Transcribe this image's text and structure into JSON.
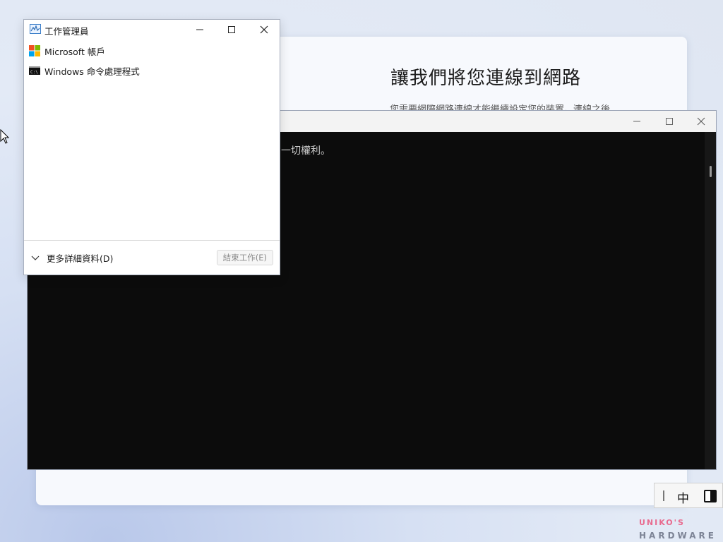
{
  "oobe": {
    "title": "讓我們將您連線到網路",
    "description": "您需要網際網路連線才能繼續設定您的裝置。連線之後，"
  },
  "cmd": {
    "visible_text": "一切權利。",
    "controls": {
      "minimize": "—",
      "maximize": "□",
      "close": "✕"
    }
  },
  "task_manager": {
    "title": "工作管理員",
    "items": [
      {
        "label": "Microsoft 帳戶",
        "icon": "microsoft-logo-icon"
      },
      {
        "label": "Windows 命令處理程式",
        "icon": "cmd-icon"
      }
    ],
    "more_details": "更多詳細資料(D)",
    "end_task": "結束工作(E)"
  },
  "ime": {
    "mode_char": "中"
  },
  "watermark": {
    "top": "UNIKO'S",
    "bottom": "HARDWARE"
  },
  "colors": {
    "accent_pink": "#e86a8e",
    "cmd_bg": "#0c0c0c"
  }
}
